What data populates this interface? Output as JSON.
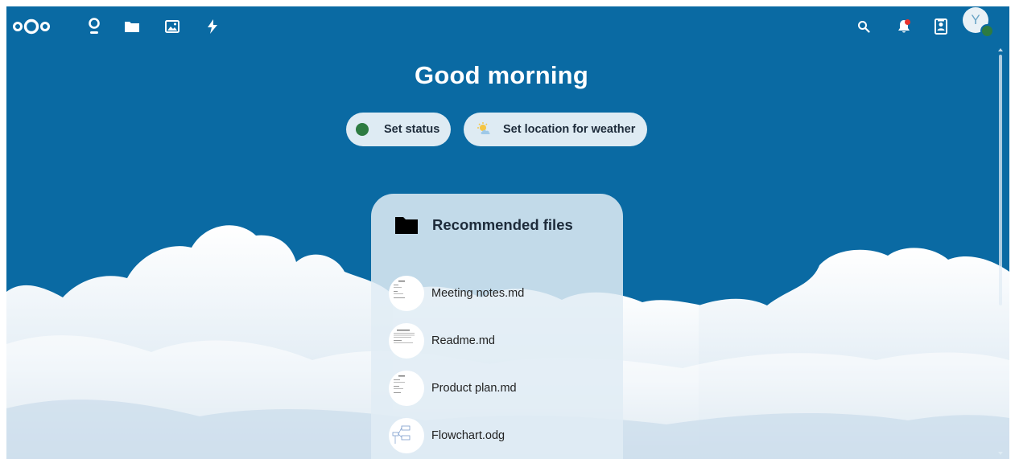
{
  "header": {
    "app_icons": [
      "nextcloud-logo-icon",
      "dashboard-icon",
      "files-icon",
      "photos-icon",
      "activity-icon"
    ],
    "right_icons": [
      "search-icon",
      "notifications-icon",
      "contacts-icon"
    ],
    "avatar_letter": "Y"
  },
  "greeting": "Good morning",
  "status": {
    "set_status_label": "Set status",
    "set_weather_label": "Set location for weather",
    "online_color": "#2d7b41"
  },
  "recommended": {
    "title": "Recommended files",
    "files": [
      {
        "name": "Meeting notes.md",
        "thumb": "document-thumbnail"
      },
      {
        "name": "Readme.md",
        "thumb": "document-thumbnail"
      },
      {
        "name": "Product plan.md",
        "thumb": "document-thumbnail"
      },
      {
        "name": "Flowchart.odg",
        "thumb": "flowchart-thumbnail"
      }
    ]
  },
  "colors": {
    "sky": "#0a6aa3",
    "panel": "#e1ecf4",
    "notification_badge": "#e9322d"
  }
}
